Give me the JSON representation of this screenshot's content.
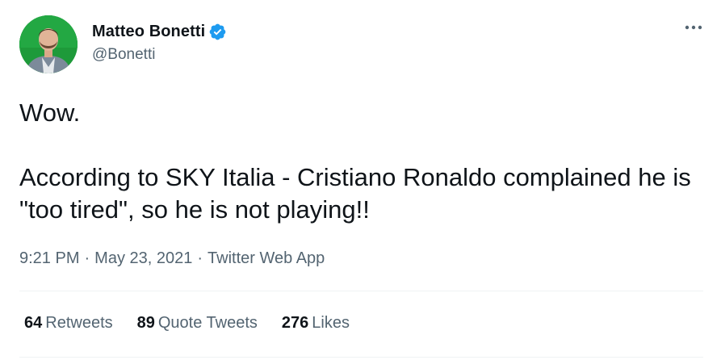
{
  "author": {
    "display_name": "Matteo Bonetti",
    "handle": "@Bonetti",
    "verified_icon": "verified-badge-icon",
    "avatar_background": "#1e9a3a"
  },
  "more_icon": "more-options-icon",
  "tweet": {
    "text": "Wow.\n\nAccording to SKY Italia - Cristiano Ronaldo complained he is \"too tired\", so he is not playing!!"
  },
  "meta": {
    "time": "9:21 PM",
    "separator": "·",
    "date": "May 23, 2021",
    "source": "Twitter Web App"
  },
  "stats": {
    "retweets": {
      "count": "64",
      "label": "Retweets"
    },
    "quote_tweets": {
      "count": "89",
      "label": "Quote Tweets"
    },
    "likes": {
      "count": "276",
      "label": "Likes"
    }
  },
  "colors": {
    "accent": "#1d9bf0",
    "text_primary": "#0f1419",
    "text_secondary": "#536471",
    "divider": "#eff3f4"
  }
}
